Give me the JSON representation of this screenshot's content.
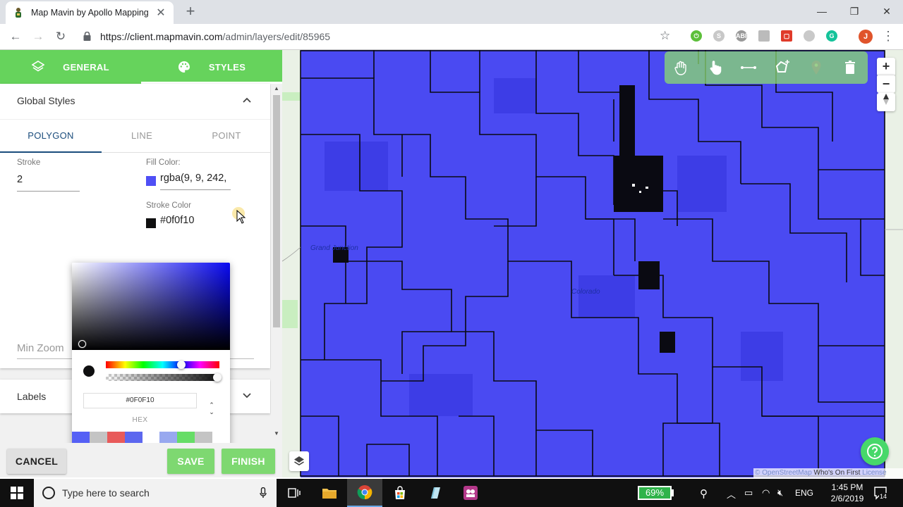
{
  "browser": {
    "tab_title": "Map Mavin by Apollo Mapping",
    "url_host": "https://client.mapmavin.com",
    "url_path": "/admin/layers/edit/85965",
    "profile_initial": "J"
  },
  "panel": {
    "tabs": [
      {
        "label": "GENERAL",
        "icon": "layers-icon"
      },
      {
        "label": "STYLES",
        "icon": "palette-icon",
        "active": true
      }
    ],
    "global_styles": {
      "title": "Global Styles",
      "expanded": true,
      "subtabs": [
        "POLYGON",
        "LINE",
        "POINT"
      ],
      "active_subtab": "POLYGON",
      "stroke_label": "Stroke",
      "stroke_value": "2",
      "fill_label": "Fill Color:",
      "fill_value": "rgba(9, 9, 242,",
      "fill_swatch": "#4f4ff5",
      "stroke_color_label": "Stroke Color",
      "stroke_color_value": "#0f0f10",
      "stroke_swatch": "#0f0f10",
      "min_zoom_label": "Min Zoom",
      "min_zoom_paren": ")"
    },
    "labels_section": {
      "title": "Labels",
      "expanded": false
    },
    "buttons": {
      "cancel": "CANCEL",
      "save": "SAVE",
      "finish": "FINISH"
    }
  },
  "color_picker": {
    "hex_value": "#0F0F10",
    "mode_label": "HEX",
    "hue_color": "#0909f2",
    "current_color": "#0f0f10",
    "presets": [
      "#5560f5",
      "#c4c4c4",
      "#e85a5a",
      "#5c67ef",
      "#ffffff",
      "#98a8ef",
      "#66dd66",
      "#c4c4c4",
      "#ffffff"
    ]
  },
  "map": {
    "fill_color": "#4a4af2",
    "labels": [
      "Grand Junction",
      "Colorado"
    ],
    "attribution": {
      "prefix": "©",
      "osm": "OpenStreetMap",
      "wof": "Who's On First",
      "license": "License"
    },
    "zoom_in": "+",
    "zoom_out": "−",
    "draw_tools": [
      "pan-hand-icon",
      "select-pointer-icon",
      "draw-line-icon",
      "draw-polygon-icon",
      "draw-marker-icon",
      "delete-trash-icon"
    ]
  },
  "taskbar": {
    "search_placeholder": "Type here to search",
    "battery": "69%",
    "language": "ENG",
    "time": "1:45 PM",
    "date": "2/6/2019",
    "notification_count": "14"
  }
}
